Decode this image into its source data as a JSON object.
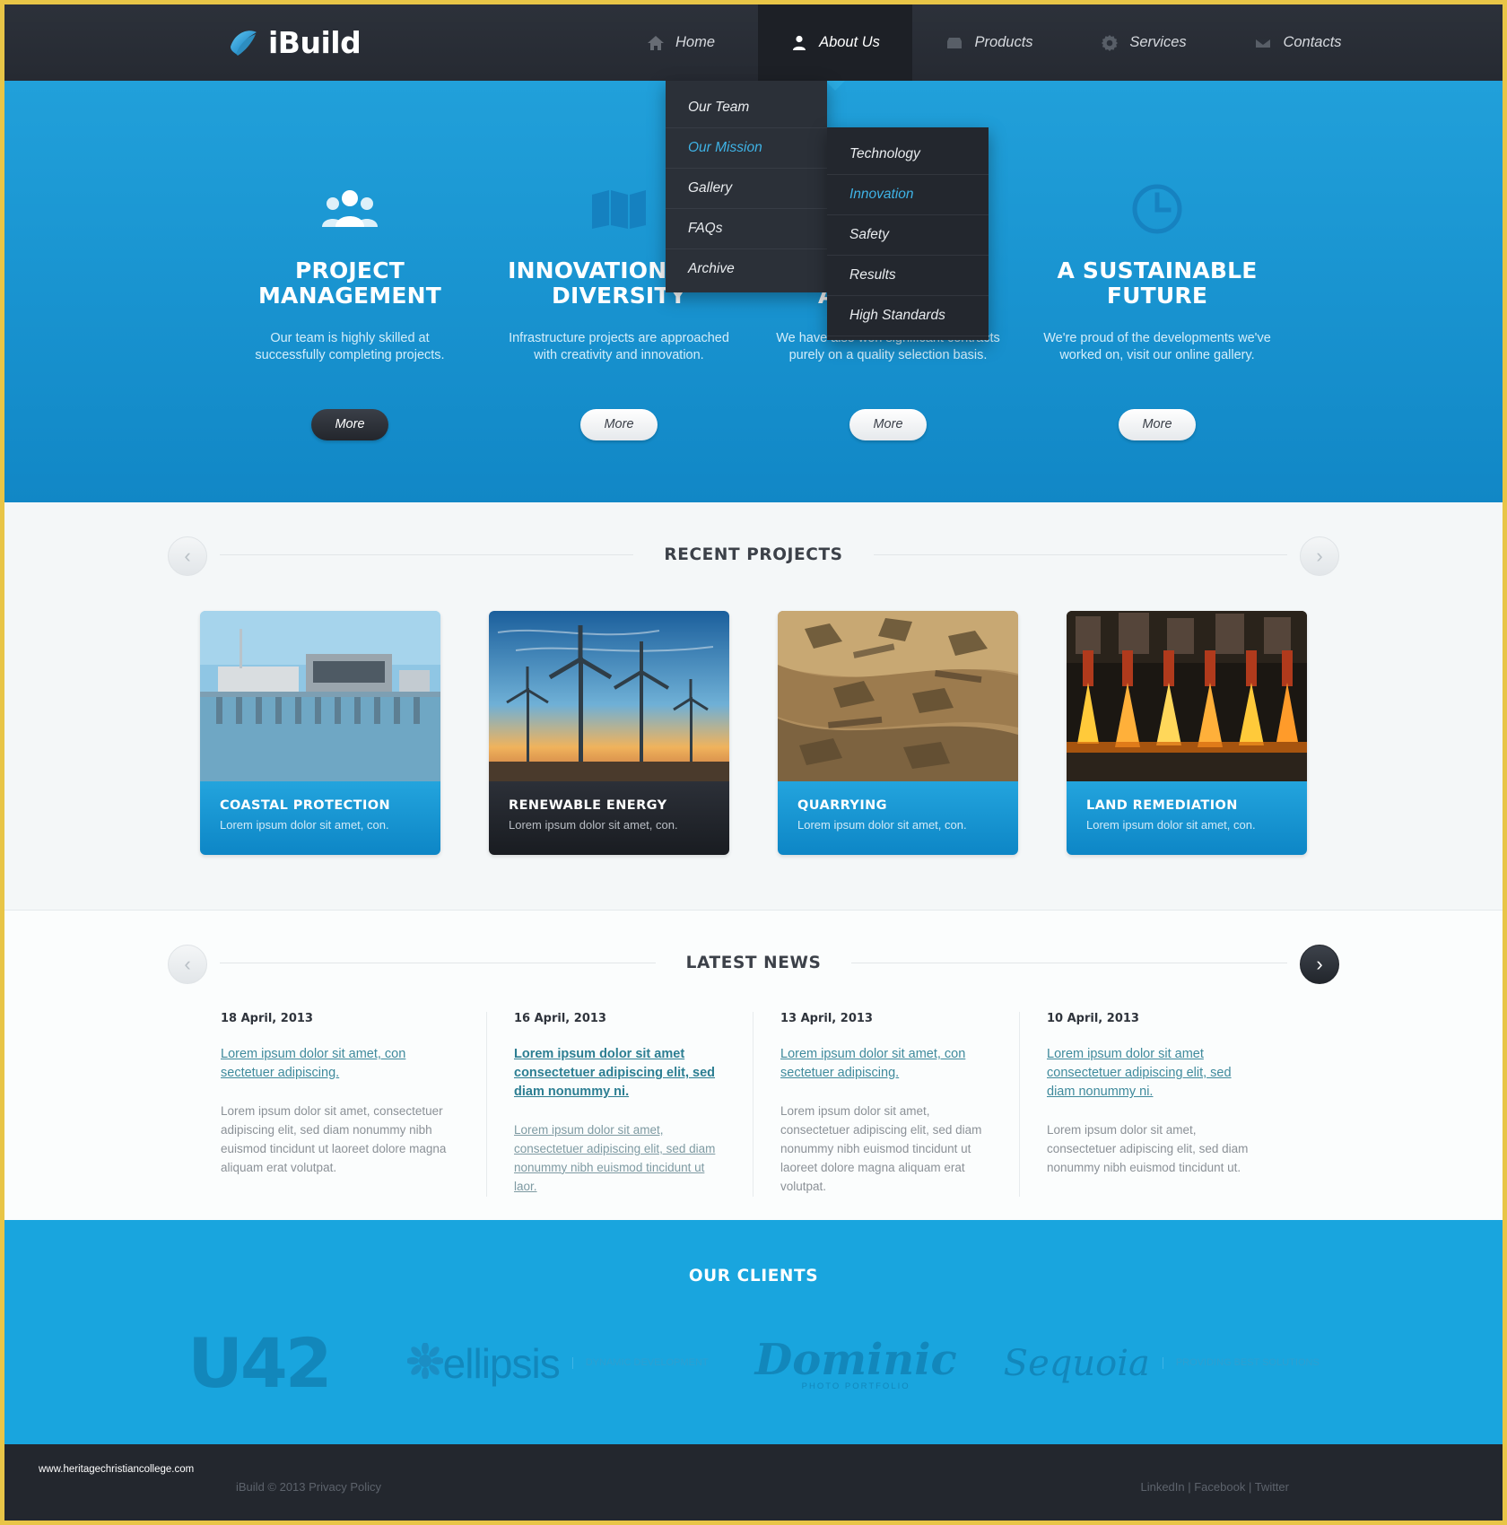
{
  "brand": {
    "name": "iBuild",
    "logo_icon": "swoosh-logo-icon"
  },
  "nav": {
    "items": [
      {
        "label": "Home",
        "icon": "home-icon",
        "active": false
      },
      {
        "label": "About Us",
        "icon": "person-icon",
        "active": true
      },
      {
        "label": "Products",
        "icon": "box-icon",
        "active": false
      },
      {
        "label": "Services",
        "icon": "gear-icon",
        "active": false
      },
      {
        "label": "Contacts",
        "icon": "envelope-icon",
        "active": false
      }
    ]
  },
  "dropdown_about": {
    "items": [
      {
        "label": "Our Team",
        "highlighted": false
      },
      {
        "label": "Our Mission",
        "highlighted": true
      },
      {
        "label": "Gallery",
        "highlighted": false
      },
      {
        "label": "FAQs",
        "highlighted": false
      },
      {
        "label": "Archive",
        "highlighted": false
      }
    ]
  },
  "dropdown_mission": {
    "items": [
      {
        "label": "Technology",
        "highlighted": false
      },
      {
        "label": "Innovation",
        "highlighted": true
      },
      {
        "label": "Safety",
        "highlighted": false
      },
      {
        "label": "Results",
        "highlighted": false
      },
      {
        "label": "High Standards",
        "highlighted": false
      }
    ]
  },
  "hero": {
    "features": [
      {
        "icon": "people-group-icon",
        "title": "PROJECT MANAGEMENT",
        "desc": "Our team is highly skilled at successfully completing projects.",
        "more_label": "More",
        "more_style": "dark"
      },
      {
        "icon": "map-icon",
        "title": "INNOVATION AND DIVERSITY",
        "desc": "Infrastructure projects are approached with creativity and innovation.",
        "more_label": "More",
        "more_style": "light"
      },
      {
        "icon": "trophy-icon",
        "title": "A QUALITY APPROACH",
        "desc": "We have also won significant contracts purely on a quality selection basis.",
        "more_label": "More",
        "more_style": "light"
      },
      {
        "icon": "clock-icon",
        "title": "A SUSTAINABLE FUTURE",
        "desc": "We're proud of the developments we've worked on, visit our online gallery.",
        "more_label": "More",
        "more_style": "light"
      }
    ]
  },
  "projects": {
    "title": "RECENT PROJECTS",
    "prev_icon": "chevron-left-icon",
    "next_icon": "chevron-right-icon",
    "cards": [
      {
        "title": "COASTAL PROTECTION",
        "desc": "Lorem ipsum dolor sit amet, con.",
        "theme": "blue",
        "image": "harbour-barrier-photo"
      },
      {
        "title": "RENEWABLE ENERGY",
        "desc": "Lorem ipsum dolor sit amet, con.",
        "theme": "dark",
        "image": "wind-turbines-photo"
      },
      {
        "title": "QUARRYING",
        "desc": "Lorem ipsum dolor sit amet, con.",
        "theme": "blue",
        "image": "quarry-excavation-photo"
      },
      {
        "title": "LAND REMEDIATION",
        "desc": "Lorem ipsum dolor sit amet, con.",
        "theme": "blue",
        "image": "steel-furnace-photo"
      }
    ]
  },
  "news": {
    "title": "LATEST NEWS",
    "prev_icon": "chevron-left-icon",
    "next_icon": "chevron-right-icon",
    "items": [
      {
        "date": "18 April, 2013",
        "link": "Lorem ipsum dolor sit amet, con sectetuer adipiscing.",
        "link_bold": false,
        "body": "Lorem ipsum dolor sit amet, consectetuer adipiscing elit, sed diam nonummy nibh euismod tincidunt ut laoreet dolore magna aliquam erat volutpat.",
        "body_linked": false
      },
      {
        "date": "16 April, 2013",
        "link": "Lorem ipsum dolor sit amet consectetuer adipiscing elit, sed diam nonummy ni.",
        "link_bold": true,
        "body": "Lorem ipsum dolor sit amet, consectetuer adipiscing elit, sed diam nonummy nibh euismod tincidunt ut laor.",
        "body_linked": true
      },
      {
        "date": "13 April, 2013",
        "link": "Lorem ipsum dolor sit amet, con sectetuer adipiscing.",
        "link_bold": false,
        "body": "Lorem ipsum dolor sit amet, consectetuer adipiscing elit, sed diam nonummy nibh euismod tincidunt ut laoreet dolore magna aliquam erat volutpat.",
        "body_linked": false
      },
      {
        "date": "10 April, 2013",
        "link": "Lorem ipsum dolor sit amet consectetuer adipiscing elit, sed diam nonummy ni.",
        "link_bold": false,
        "body": "Lorem ipsum dolor sit amet, consectetuer adipiscing elit, sed diam nonummy nibh euismod tincidunt ut.",
        "body_linked": false
      }
    ]
  },
  "clients": {
    "title": "OUR CLIENTS",
    "logos": [
      {
        "name": "U42",
        "tagline": ""
      },
      {
        "name": "ellipsis",
        "tagline": "DYNAMIC DEVELOPMENT"
      },
      {
        "name": "Dominic",
        "tagline": "PHOTO PORTFOLIO"
      },
      {
        "name": "Sequoia",
        "tagline": "PROVIDING BEST SOLUTIONS"
      }
    ]
  },
  "footer": {
    "site": "www.heritagechristiancollege.com",
    "copyright": "iBuild © 2013 Privacy Policy",
    "social": [
      "LinkedIn",
      "Facebook",
      "Twitter"
    ],
    "social_sep": " | "
  },
  "colors": {
    "accent_blue": "#19a5de",
    "dark": "#23272e",
    "border_yellow": "#e8c547",
    "link_teal": "#3f8a9c"
  }
}
